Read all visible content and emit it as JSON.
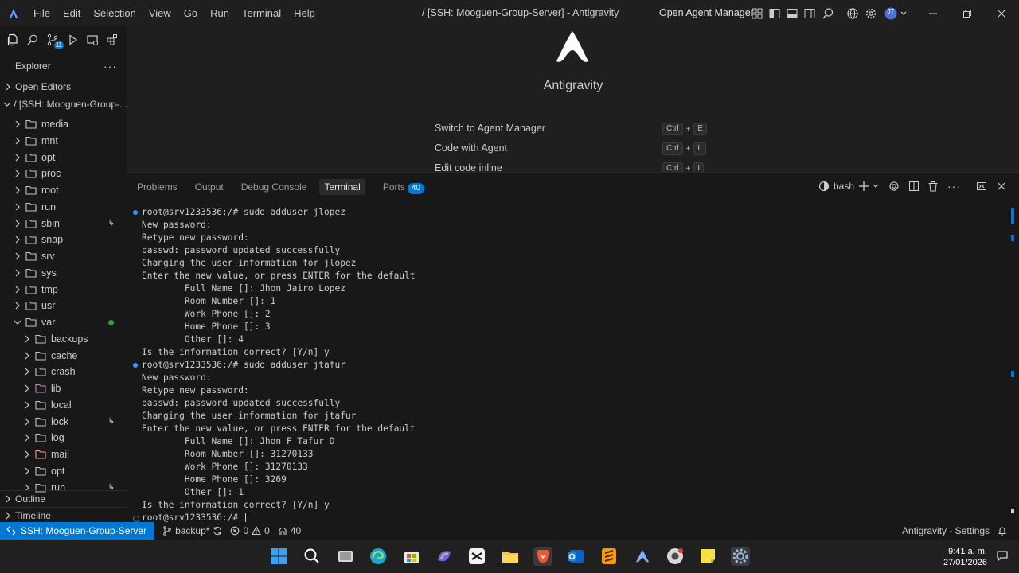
{
  "titlebar": {
    "menu": [
      "File",
      "Edit",
      "Selection",
      "View",
      "Go",
      "Run",
      "Terminal",
      "Help"
    ],
    "window_title": "/ [SSH: Mooguen-Group-Server] - Antigravity",
    "agent_manager_label": "Open Agent Manager",
    "avatar_initials": "JT"
  },
  "explorer": {
    "title": "Explorer",
    "more_label": "···",
    "search_badge": "11",
    "open_editors_label": "Open Editors",
    "root_label": "/ [SSH: Mooguen-Group-...",
    "items": [
      {
        "label": "media",
        "indent": 0,
        "expanded": false,
        "mark": ""
      },
      {
        "label": "mnt",
        "indent": 0,
        "expanded": false,
        "mark": ""
      },
      {
        "label": "opt",
        "indent": 0,
        "expanded": false,
        "mark": ""
      },
      {
        "label": "proc",
        "indent": 0,
        "expanded": false,
        "mark": ""
      },
      {
        "label": "root",
        "indent": 0,
        "expanded": false,
        "mark": ""
      },
      {
        "label": "run",
        "indent": 0,
        "expanded": false,
        "mark": ""
      },
      {
        "label": "sbin",
        "indent": 0,
        "expanded": false,
        "mark": "↳"
      },
      {
        "label": "snap",
        "indent": 0,
        "expanded": false,
        "mark": ""
      },
      {
        "label": "srv",
        "indent": 0,
        "expanded": false,
        "mark": ""
      },
      {
        "label": "sys",
        "indent": 0,
        "expanded": false,
        "mark": ""
      },
      {
        "label": "tmp",
        "indent": 0,
        "expanded": false,
        "mark": ""
      },
      {
        "label": "usr",
        "indent": 0,
        "expanded": false,
        "mark": ""
      },
      {
        "label": "var",
        "indent": 0,
        "expanded": true,
        "mark": "dot"
      },
      {
        "label": "backups",
        "indent": 1,
        "expanded": false,
        "mark": ""
      },
      {
        "label": "cache",
        "indent": 1,
        "expanded": false,
        "mark": ""
      },
      {
        "label": "crash",
        "indent": 1,
        "expanded": false,
        "mark": ""
      },
      {
        "label": "lib",
        "indent": 1,
        "expanded": false,
        "mark": ""
      },
      {
        "label": "local",
        "indent": 1,
        "expanded": false,
        "mark": ""
      },
      {
        "label": "lock",
        "indent": 1,
        "expanded": false,
        "mark": "↳"
      },
      {
        "label": "log",
        "indent": 1,
        "expanded": false,
        "mark": ""
      },
      {
        "label": "mail",
        "indent": 1,
        "expanded": false,
        "mark": ""
      },
      {
        "label": "opt",
        "indent": 1,
        "expanded": false,
        "mark": ""
      },
      {
        "label": "run",
        "indent": 1,
        "expanded": false,
        "mark": "↳"
      }
    ],
    "outline_label": "Outline",
    "timeline_label": "Timeline"
  },
  "welcome": {
    "title": "Antigravity",
    "shortcuts": [
      {
        "label": "Switch to Agent Manager",
        "keys": [
          "Ctrl",
          "+",
          "E"
        ]
      },
      {
        "label": "Code with Agent",
        "keys": [
          "Ctrl",
          "+",
          "L"
        ]
      },
      {
        "label": "Edit code inline",
        "keys": [
          "Ctrl",
          "+",
          "I"
        ]
      }
    ]
  },
  "panel": {
    "tabs": [
      "Problems",
      "Output",
      "Debug Console",
      "Terminal",
      "Ports"
    ],
    "active_tab": "Terminal",
    "ports_count": "40",
    "shell_label": "bash"
  },
  "terminal": {
    "lines": [
      {
        "text": "root@srv1233536:/# sudo adduser jlopez",
        "dot": "#3794ff"
      },
      {
        "text": "New password:",
        "dot": ""
      },
      {
        "text": "Retype new password:",
        "dot": ""
      },
      {
        "text": "passwd: password updated successfully",
        "dot": ""
      },
      {
        "text": "Changing the user information for jlopez",
        "dot": ""
      },
      {
        "text": "Enter the new value, or press ENTER for the default",
        "dot": ""
      },
      {
        "text": "        Full Name []: Jhon Jairo Lopez",
        "dot": ""
      },
      {
        "text": "        Room Number []: 1",
        "dot": ""
      },
      {
        "text": "        Work Phone []: 2",
        "dot": ""
      },
      {
        "text": "        Home Phone []: 3",
        "dot": ""
      },
      {
        "text": "        Other []: 4",
        "dot": ""
      },
      {
        "text": "Is the information correct? [Y/n] y",
        "dot": ""
      },
      {
        "text": "root@srv1233536:/# sudo adduser jtafur",
        "dot": "#3794ff"
      },
      {
        "text": "New password:",
        "dot": ""
      },
      {
        "text": "Retype new password:",
        "dot": ""
      },
      {
        "text": "passwd: password updated successfully",
        "dot": ""
      },
      {
        "text": "Changing the user information for jtafur",
        "dot": ""
      },
      {
        "text": "Enter the new value, or press ENTER for the default",
        "dot": ""
      },
      {
        "text": "        Full Name []: Jhon F Tafur D",
        "dot": ""
      },
      {
        "text": "        Room Number []: 31270133",
        "dot": ""
      },
      {
        "text": "        Work Phone []: 31270133",
        "dot": ""
      },
      {
        "text": "        Home Phone []: 3269",
        "dot": ""
      },
      {
        "text": "        Other []: 1",
        "dot": ""
      },
      {
        "text": "Is the information correct? [Y/n] y",
        "dot": ""
      },
      {
        "text": "root@srv1233536:/# ",
        "dot": "#6e6e6e",
        "cursor": true
      }
    ]
  },
  "statusbar": {
    "remote": "SSH: Mooguen-Group-Server",
    "branch": "backup*",
    "errors": "0",
    "warnings": "0",
    "ports": "40",
    "settings_label": "Antigravity - Settings"
  },
  "taskbar": {
    "time": "9:41 a. m.",
    "date": "27/01/2026"
  },
  "colors": {
    "accent": "#0078d4",
    "background": "#181818",
    "editor": "#1f1f1f",
    "modified_dot": "#2ea043"
  }
}
